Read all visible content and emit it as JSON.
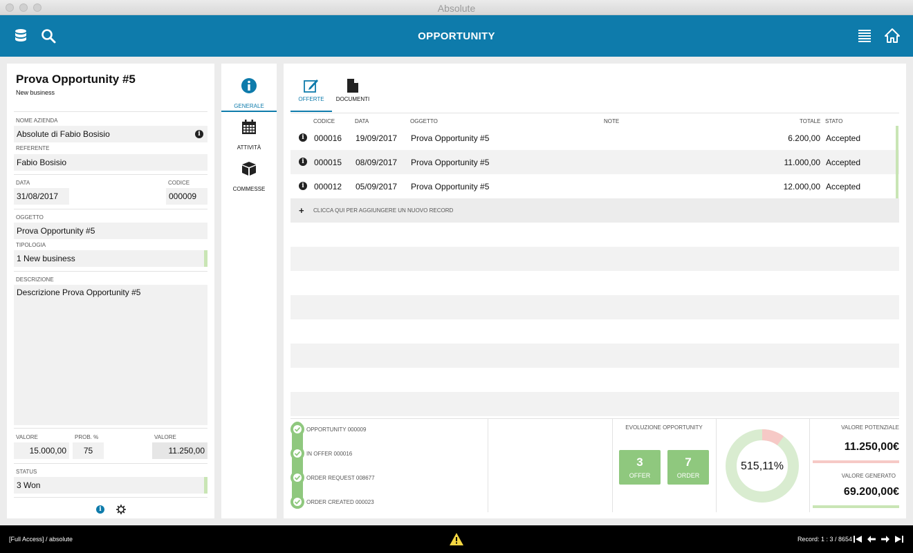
{
  "window": {
    "title": "Absolute"
  },
  "header": {
    "title": "OPPORTUNITY"
  },
  "record": {
    "title": "Prova Opportunity #5",
    "subtitle": "New business",
    "fields": {
      "nome_azienda": {
        "label": "NOME AZIENDA",
        "value": "Absolute di Fabio Bosisio"
      },
      "referente": {
        "label": "REFERENTE",
        "value": "Fabio Bosisio"
      },
      "data": {
        "label": "DATA",
        "value": "31/08/2017"
      },
      "codice": {
        "label": "CODICE",
        "value": "000009"
      },
      "oggetto": {
        "label": "OGGETTO",
        "value": "Prova Opportunity #5"
      },
      "tipologia": {
        "label": "TIPOLOGIA",
        "value": "1 New business"
      },
      "descrizione": {
        "label": "DESCRIZIONE",
        "value": "Descrizione Prova Opportunity #5"
      },
      "valore": {
        "label": "VALORE",
        "value": "15.000,00"
      },
      "prob": {
        "label": "PROB. %",
        "value": "75"
      },
      "valore2": {
        "label": "VALORE",
        "value": "11.250,00"
      },
      "status": {
        "label": "STATUS",
        "value": "3 Won"
      }
    }
  },
  "side_nav": [
    {
      "label": "GENERALE",
      "icon": "info-icon",
      "active": true
    },
    {
      "label": "ATTIVITÀ",
      "icon": "calendar-icon",
      "active": false
    },
    {
      "label": "COMMESSE",
      "icon": "box-icon",
      "active": false
    }
  ],
  "tabs": [
    {
      "label": "OFFERTE",
      "icon": "edit-icon",
      "active": true
    },
    {
      "label": "DOCUMENTI",
      "icon": "document-icon",
      "active": false
    }
  ],
  "grid": {
    "columns": {
      "codice": "CODICE",
      "data": "DATA",
      "oggetto": "OGGETTO",
      "note": "NOTE",
      "totale": "TOTALE",
      "stato": "STATO"
    },
    "rows": [
      {
        "codice": "000016",
        "data": "19/09/2017",
        "oggetto": "Prova Opportunity #5",
        "note": "",
        "totale": "6.200,00",
        "stato": "Accepted"
      },
      {
        "codice": "000015",
        "data": "08/09/2017",
        "oggetto": "Prova Opportunity #5",
        "note": "",
        "totale": "11.000,00",
        "stato": "Accepted"
      },
      {
        "codice": "000012",
        "data": "05/09/2017",
        "oggetto": "Prova Opportunity #5",
        "note": "",
        "totale": "12.000,00",
        "stato": "Accepted"
      }
    ],
    "add_label": "CLICCA QUI PER AGGIUNGERE UN NUOVO RECORD"
  },
  "workflow": [
    "OPPORTUNITY 000009",
    "IN OFFER 000016",
    "ORDER REQUEST 008677",
    "ORDER CREATED 000023"
  ],
  "evolution": {
    "title": "EVOLUZIONE OPPORTUNITY",
    "offer": {
      "count": "3",
      "label": "OFFER"
    },
    "order": {
      "count": "7",
      "label": "ORDER"
    }
  },
  "donut": {
    "label": "515,11%",
    "primary_fraction": 0.9,
    "colors": {
      "main": "#d9ecd0",
      "accent": "#f6c9c6"
    }
  },
  "valori": {
    "potenziale_label": "VALORE POTENZIALE",
    "potenziale_value": "11.250,00€",
    "generato_label": "VALORE GENERATO",
    "generato_value": "69.200,00€"
  },
  "status_bar": {
    "access": "[Full Access] / absolute",
    "record": "Record: 1 : 3 / 8654"
  },
  "colors": {
    "header": "#0e7bab",
    "green": "#8fc87e",
    "light_green": "#c9e5b5",
    "pink": "#f6c9c6"
  }
}
